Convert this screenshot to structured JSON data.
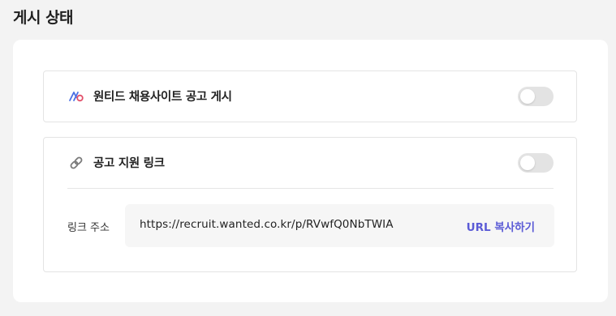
{
  "page": {
    "title": "게시 상태"
  },
  "wanted_posting": {
    "label": "원티드 채용사이트 공고 게시",
    "icon": "wanted-logo-icon",
    "toggle_on": false
  },
  "apply_link": {
    "label": "공고 지원 링크",
    "icon": "link-icon",
    "toggle_on": false,
    "address_label": "링크 주소",
    "url": "https://recruit.wanted.co.kr/p/RVwfQ0NbTWIA",
    "copy_label": "URL 복사하기"
  },
  "colors": {
    "accent": "#5b5bd6",
    "toggle_off": "#e3e3e3",
    "background": "#f3f3f3"
  }
}
